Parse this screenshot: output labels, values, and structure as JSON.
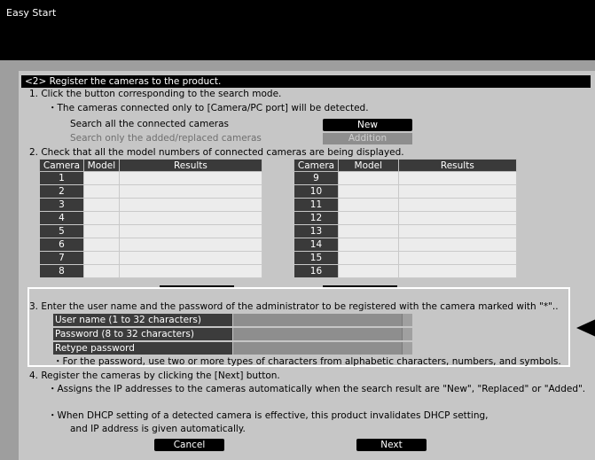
{
  "window": {
    "title": "Easy Start"
  },
  "step2": {
    "header": "<2> Register the cameras to the product.",
    "item1": "1. Click the button corresponding to the search mode.",
    "item1_note": "・The cameras connected only to [Camera/PC port] will be detected.",
    "search_all_label": "Search all the connected cameras",
    "search_only_label": "Search only the  added/replaced cameras",
    "new_button": "New",
    "addition_button": "Addition",
    "item2": "2. Check that all the model numbers of connected cameras are being displayed."
  },
  "table": {
    "columns": [
      "Camera",
      "Model",
      "Results"
    ],
    "left_rows": [
      {
        "camera": "1",
        "model": "",
        "result": ""
      },
      {
        "camera": "2",
        "model": "",
        "result": ""
      },
      {
        "camera": "3",
        "model": "",
        "result": ""
      },
      {
        "camera": "4",
        "model": "",
        "result": ""
      },
      {
        "camera": "5",
        "model": "",
        "result": ""
      },
      {
        "camera": "6",
        "model": "",
        "result": ""
      },
      {
        "camera": "7",
        "model": "",
        "result": ""
      },
      {
        "camera": "8",
        "model": "",
        "result": ""
      }
    ],
    "right_rows": [
      {
        "camera": "9",
        "model": "",
        "result": ""
      },
      {
        "camera": "10",
        "model": "",
        "result": ""
      },
      {
        "camera": "11",
        "model": "",
        "result": ""
      },
      {
        "camera": "12",
        "model": "",
        "result": ""
      },
      {
        "camera": "13",
        "model": "",
        "result": ""
      },
      {
        "camera": "14",
        "model": "",
        "result": ""
      },
      {
        "camera": "15",
        "model": "",
        "result": ""
      },
      {
        "camera": "16",
        "model": "",
        "result": ""
      }
    ]
  },
  "credentials": {
    "item3": "3. Enter the user name and the password of the administrator to be registered with the camera marked with \"*\"..",
    "user_name_label": "User name (1 to 32 characters)",
    "password_label": "Password (8 to 32 characters)",
    "retype_label": "Retype password",
    "user_name_value": "",
    "password_value": "",
    "retype_value": "",
    "note": "・For the password, use two or more types of characters from alphabetic characters, numbers, and symbols."
  },
  "step4": {
    "item4": "4. Register the cameras by clicking the [Next] button.",
    "note1": "・Assigns the IP addresses to the cameras automatically when the search result are \"New\", \"Replaced\" or \"Added\".",
    "note2": "・When DHCP setting of a detected camera is effective, this product invalidates DHCP setting,",
    "note3": "and IP address is given automatically."
  },
  "footer": {
    "cancel_button": "Cancel",
    "next_button": "Next"
  },
  "icons": {
    "callout": "callout-arrow-icon"
  },
  "colors": {
    "titlebar": "#000000",
    "background": "#c6c6c6",
    "header_cell": "#3a3a3a",
    "popup_border": "#ffffff"
  }
}
